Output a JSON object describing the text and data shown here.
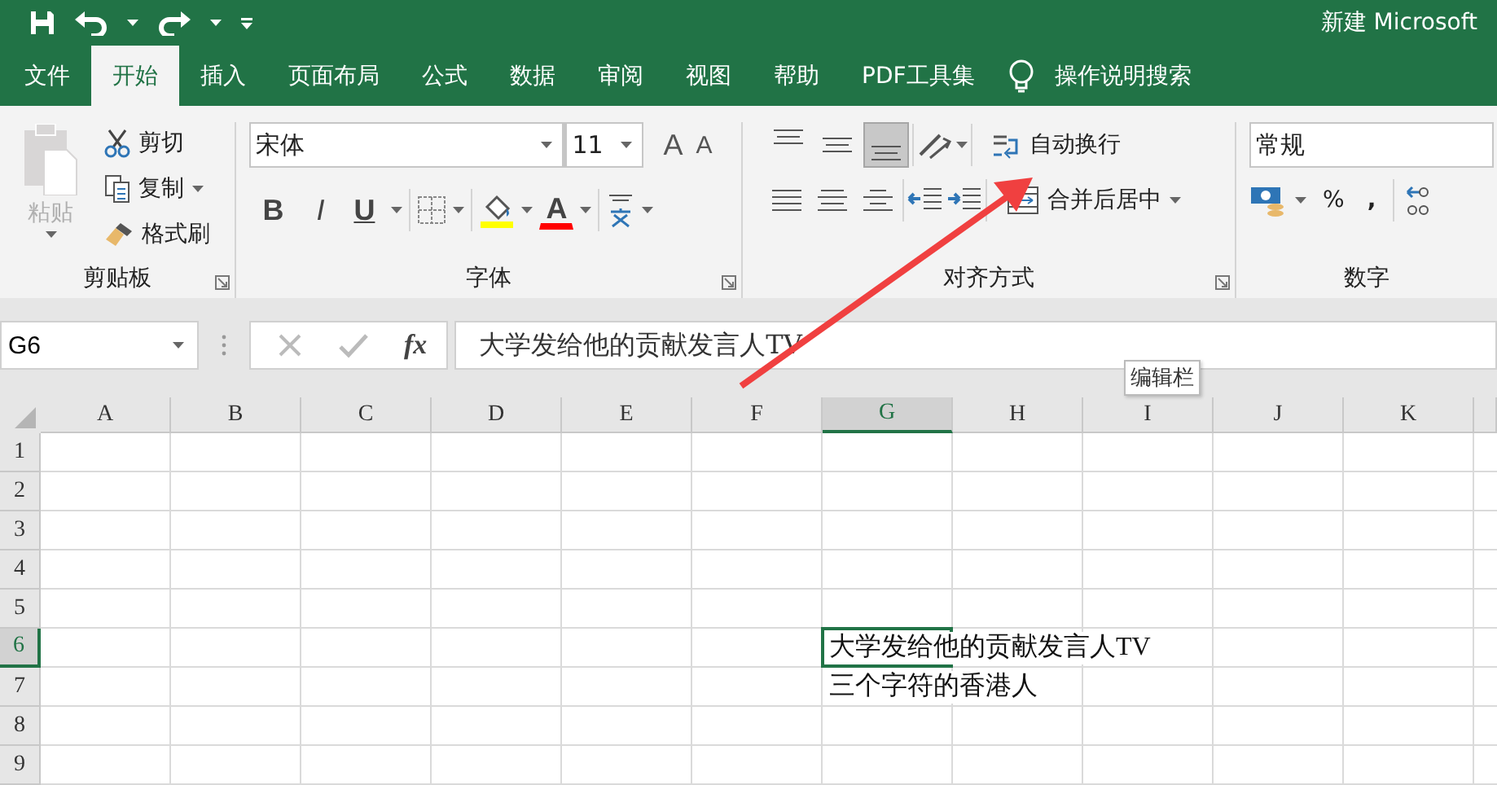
{
  "title_bar": {
    "title": "新建 Microsoft"
  },
  "tabs": [
    {
      "label": "文件",
      "selected": false
    },
    {
      "label": "开始",
      "selected": true
    },
    {
      "label": "插入",
      "selected": false
    },
    {
      "label": "页面布局",
      "selected": false
    },
    {
      "label": "公式",
      "selected": false
    },
    {
      "label": "数据",
      "selected": false
    },
    {
      "label": "审阅",
      "selected": false
    },
    {
      "label": "视图",
      "selected": false
    },
    {
      "label": "帮助",
      "selected": false
    },
    {
      "label": "PDF工具集",
      "selected": false
    }
  ],
  "tell_me": {
    "placeholder": "操作说明搜索"
  },
  "clipboard": {
    "label": "剪贴板",
    "paste": "粘贴",
    "paste_disabled": true,
    "cut": "剪切",
    "copy": "复制",
    "format_painter": "格式刷"
  },
  "font": {
    "label": "字体",
    "name": "宋体",
    "size": "11",
    "grow": "A",
    "shrink": "A",
    "bold": "B",
    "italic": "I",
    "underline": "U",
    "font_color": "A"
  },
  "alignment": {
    "label": "对齐方式",
    "vertical": [
      {
        "selected": false
      },
      {
        "selected": false
      },
      {
        "selected": true
      }
    ],
    "wrap_text": "自动换行",
    "merge_center": "合并后居中"
  },
  "number": {
    "label": "数字",
    "format": "常规",
    "percent": "%",
    "comma": ","
  },
  "formula_bar": {
    "name_box": "G6",
    "function_label": "fx",
    "formula": "大学发给他的贡献发言人TV",
    "tooltip": "编辑栏"
  },
  "grid": {
    "columns": [
      {
        "label": "A",
        "selected": false
      },
      {
        "label": "B",
        "selected": false
      },
      {
        "label": "C",
        "selected": false
      },
      {
        "label": "D",
        "selected": false
      },
      {
        "label": "E",
        "selected": false
      },
      {
        "label": "F",
        "selected": false
      },
      {
        "label": "G",
        "selected": true
      },
      {
        "label": "H",
        "selected": false
      },
      {
        "label": "I",
        "selected": false
      },
      {
        "label": "J",
        "selected": false
      },
      {
        "label": "K",
        "selected": false
      }
    ],
    "rows": [
      {
        "label": "1",
        "selected": false
      },
      {
        "label": "2",
        "selected": false
      },
      {
        "label": "3",
        "selected": false
      },
      {
        "label": "4",
        "selected": false
      },
      {
        "label": "5",
        "selected": false
      },
      {
        "label": "6",
        "selected": true,
        "cells": [
          null,
          null,
          null,
          null,
          null,
          null,
          "大学发给他的贡献发言人TV"
        ]
      },
      {
        "label": "7",
        "selected": false,
        "cells": [
          null,
          null,
          null,
          null,
          null,
          null,
          "三个字符的香港人"
        ]
      },
      {
        "label": "8",
        "selected": false
      },
      {
        "label": "9",
        "selected": false
      }
    ]
  }
}
